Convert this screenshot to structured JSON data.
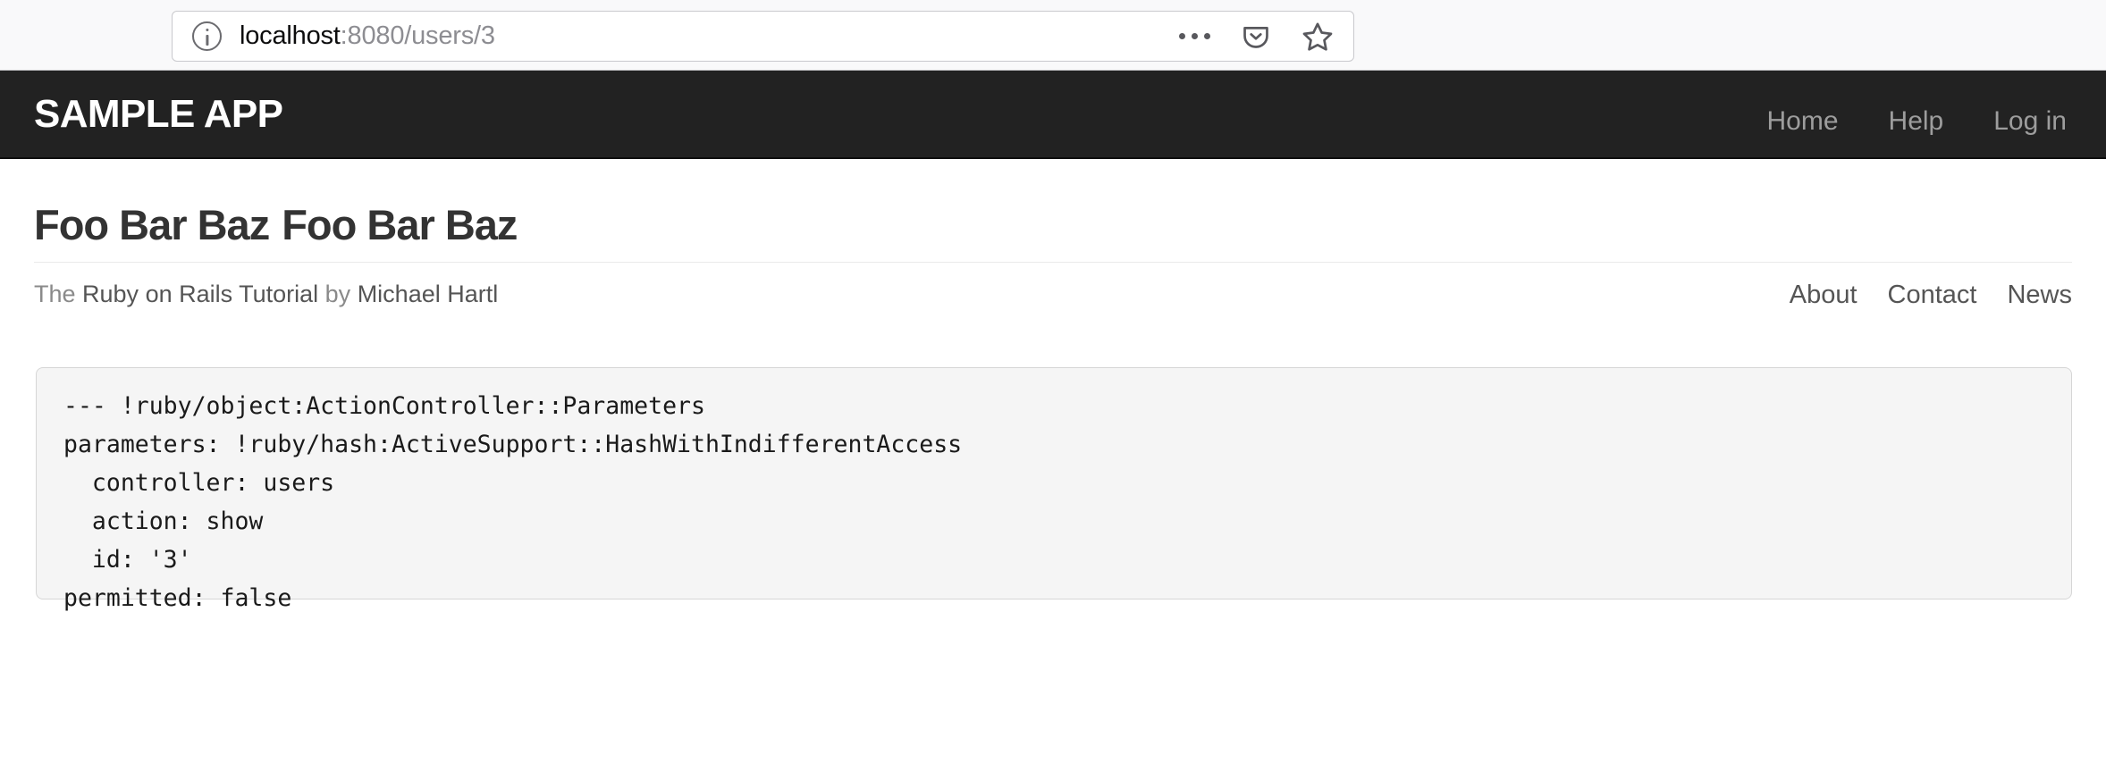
{
  "browser": {
    "identity_icon": "info-circle-icon",
    "url_host": "localhost",
    "url_rest": ":8080/users/3",
    "url_full": "localhost:8080/users/3",
    "actions": [
      {
        "name": "page-actions-icon",
        "label": "•••"
      },
      {
        "name": "pocket-icon",
        "label": "Save to Pocket"
      },
      {
        "name": "bookmark-star-icon",
        "label": "Bookmark this page"
      }
    ]
  },
  "navbar": {
    "brand": "SAMPLE APP",
    "links": [
      {
        "label": "Home"
      },
      {
        "label": "Help"
      },
      {
        "label": "Log in"
      }
    ]
  },
  "main": {
    "heading_part1": "Foo Bar Baz",
    "heading_part2": "Foo Bar Baz",
    "debug_dump": "--- !ruby/object:ActionController::Parameters\nparameters: !ruby/hash:ActiveSupport::HashWithIndifferentAccess\n  controller: users\n  action: show\n  id: '3'\npermitted: false"
  },
  "footer": {
    "text_the": "The ",
    "link_tutorial": "Ruby on Rails Tutorial",
    "text_by": " by ",
    "link_author": "Michael Hartl",
    "links": [
      {
        "label": "About"
      },
      {
        "label": "Contact"
      },
      {
        "label": "News"
      }
    ]
  },
  "colors": {
    "navbar_bg": "#222222",
    "brand_text": "#ffffff",
    "nav_link": "#9d9d9d",
    "heading": "#333333",
    "code_bg": "#f5f5f5",
    "code_border": "#d6d6d6",
    "chrome_bg": "#f9f9fa"
  }
}
